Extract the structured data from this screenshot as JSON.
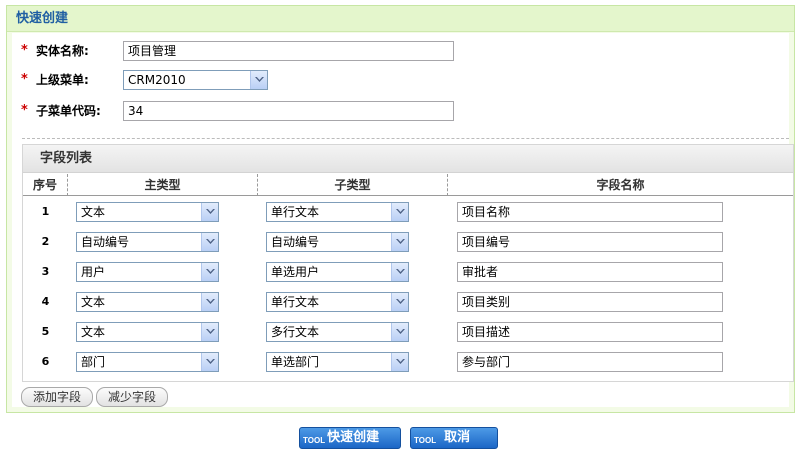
{
  "panel": {
    "title": "快速创建"
  },
  "form": {
    "entity_name": {
      "label": "实体名称:",
      "value": "项目管理"
    },
    "parent_menu": {
      "label": "上级菜单:",
      "value": "CRM2010"
    },
    "submenu_code": {
      "label": "子菜单代码:",
      "value": "34"
    }
  },
  "field_list": {
    "title": "字段列表",
    "columns": [
      "序号",
      "主类型",
      "子类型",
      "字段名称"
    ],
    "rows": [
      {
        "num": "1",
        "main_type": "文本",
        "sub_type": "单行文本",
        "field_name": "项目名称"
      },
      {
        "num": "2",
        "main_type": "自动编号",
        "sub_type": "自动编号",
        "field_name": "项目编号"
      },
      {
        "num": "3",
        "main_type": "用户",
        "sub_type": "单选用户",
        "field_name": "审批者"
      },
      {
        "num": "4",
        "main_type": "文本",
        "sub_type": "单行文本",
        "field_name": "项目类别"
      },
      {
        "num": "5",
        "main_type": "文本",
        "sub_type": "多行文本",
        "field_name": "项目描述"
      },
      {
        "num": "6",
        "main_type": "部门",
        "sub_type": "单选部门",
        "field_name": "参与部门"
      }
    ]
  },
  "buttons": {
    "add_field": "添加字段",
    "remove_field": "减少字段",
    "quick_create": "快速创建",
    "cancel": "取消",
    "tool_tag": "TOOL"
  },
  "colors": {
    "header_text": "#1f5fa3",
    "panel_border": "#c7e6a4",
    "required_mark": "#cc0000",
    "action_button": "#1b66c6"
  },
  "icons": {
    "required": "asterisk",
    "dropdown": "chevron-down-icon"
  }
}
